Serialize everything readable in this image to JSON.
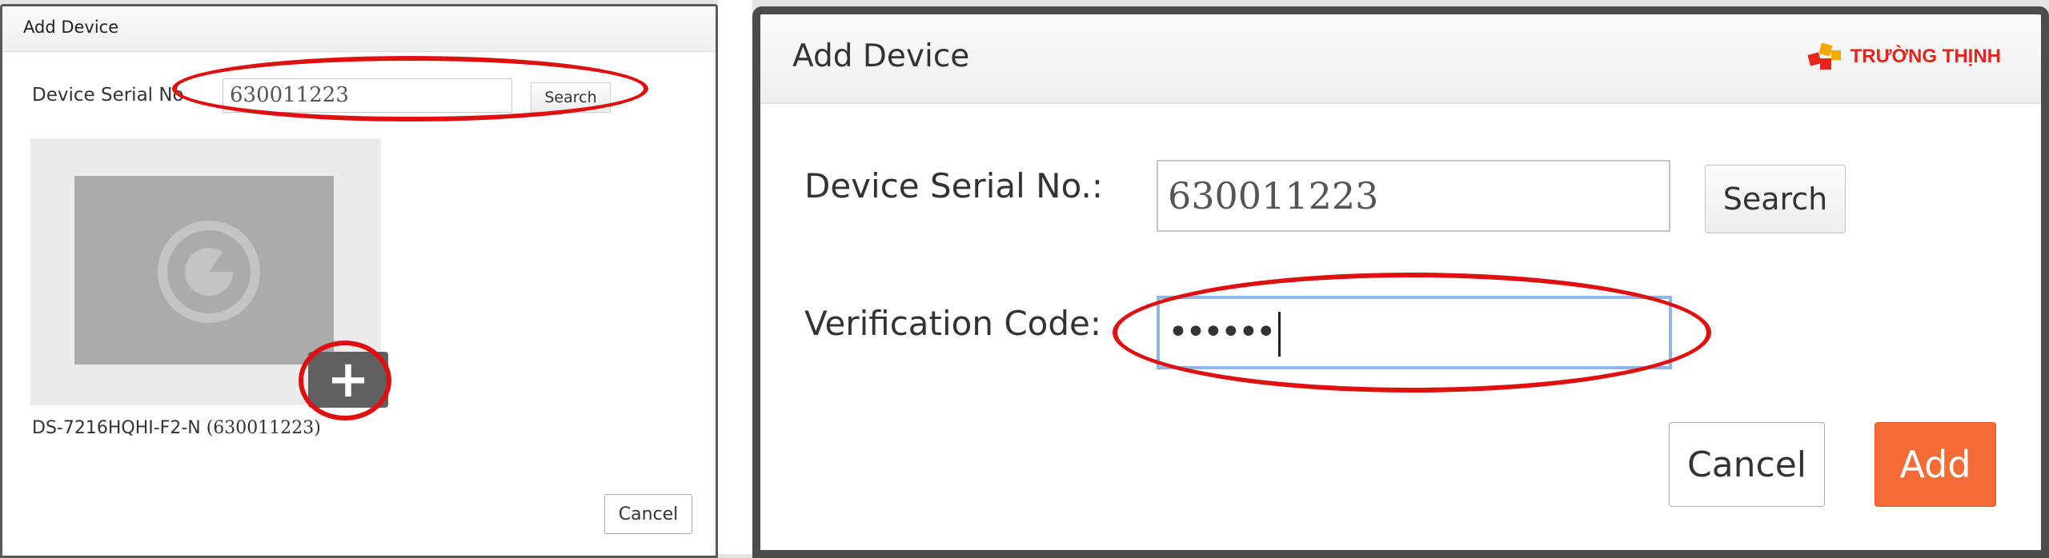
{
  "left_dialog": {
    "title": "Add Device",
    "serial_label": "Device Serial No",
    "serial_value": "630011223",
    "search_label": "Search",
    "device_name": "DS-7216HQHI-F2-N",
    "device_serial": "(630011223)",
    "add_icon": "plus-icon",
    "cancel_label": "Cancel"
  },
  "right_dialog": {
    "title": "Add Device",
    "brand": "TRƯỜNG THỊNH",
    "serial_label": "Device Serial No.:",
    "serial_value": "630011223",
    "search_label": "Search",
    "code_label": "Verification Code:",
    "code_value": "••••••",
    "cancel_label": "Cancel",
    "add_label": "Add"
  },
  "colors": {
    "annotation": "#e01010",
    "add_button": "#f46b35",
    "focus_border": "#8fb6e8"
  }
}
